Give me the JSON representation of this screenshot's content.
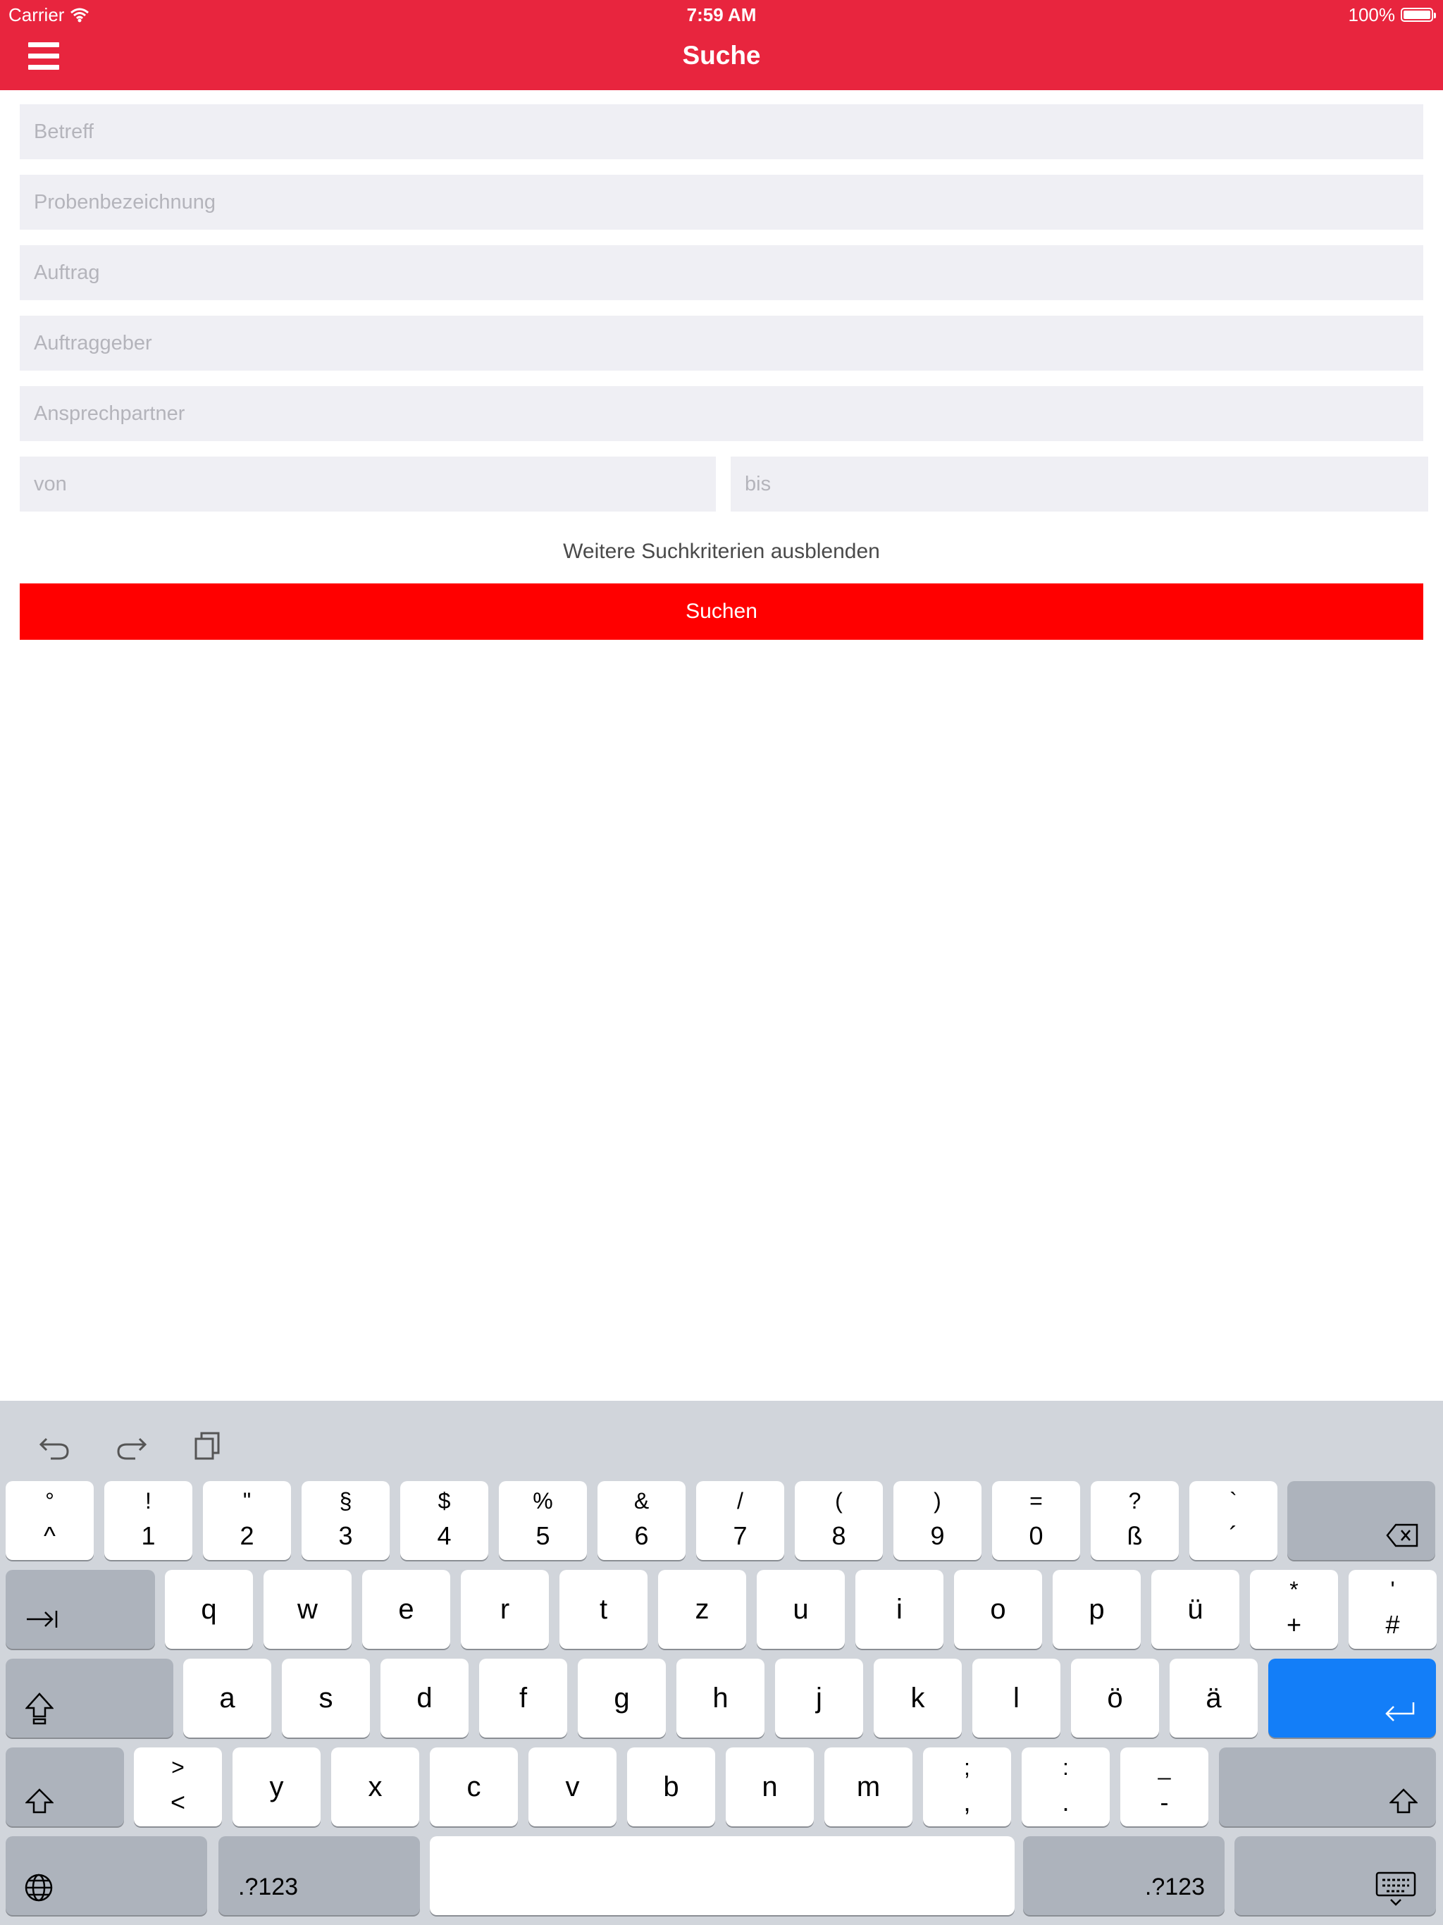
{
  "status_bar": {
    "carrier": "Carrier",
    "time": "7:59 AM",
    "battery": "100%"
  },
  "nav": {
    "title": "Suche"
  },
  "form": {
    "betreff_placeholder": "Betreff",
    "probenbezeichnung_placeholder": "Probenbezeichnung",
    "auftrag_placeholder": "Auftrag",
    "auftraggeber_placeholder": "Auftraggeber",
    "ansprechpartner_placeholder": "Ansprechpartner",
    "von_placeholder": "von",
    "bis_placeholder": "bis",
    "more_criteria_link": "Weitere Suchkriterien ausblenden",
    "search_button": "Suchen"
  },
  "keyboard": {
    "row1": [
      {
        "top": "°",
        "bot": "^"
      },
      {
        "top": "!",
        "bot": "1"
      },
      {
        "top": "\"",
        "bot": "2"
      },
      {
        "top": "§",
        "bot": "3"
      },
      {
        "top": "$",
        "bot": "4"
      },
      {
        "top": "%",
        "bot": "5"
      },
      {
        "top": "&",
        "bot": "6"
      },
      {
        "top": "/",
        "bot": "7"
      },
      {
        "top": "(",
        "bot": "8"
      },
      {
        "top": ")",
        "bot": "9"
      },
      {
        "top": "=",
        "bot": "0"
      },
      {
        "top": "?",
        "bot": "ß"
      },
      {
        "top": "`",
        "bot": "´"
      }
    ],
    "row2": [
      "q",
      "w",
      "e",
      "r",
      "t",
      "z",
      "u",
      "i",
      "o",
      "p",
      "ü"
    ],
    "row2_extra": [
      {
        "top": "*",
        "bot": "+"
      },
      {
        "top": "'",
        "bot": "#"
      }
    ],
    "row3": [
      "a",
      "s",
      "d",
      "f",
      "g",
      "h",
      "j",
      "k",
      "l",
      "ö",
      "ä"
    ],
    "row4_first": {
      "top": ">",
      "bot": "<"
    },
    "row4": [
      "y",
      "x",
      "c",
      "v",
      "b",
      "n",
      "m"
    ],
    "row4_extra": [
      {
        "top": ";",
        "bot": ","
      },
      {
        "top": ":",
        "bot": "."
      },
      {
        "top": "_",
        "bot": "-"
      }
    ],
    "numbers_label": ".?123"
  }
}
